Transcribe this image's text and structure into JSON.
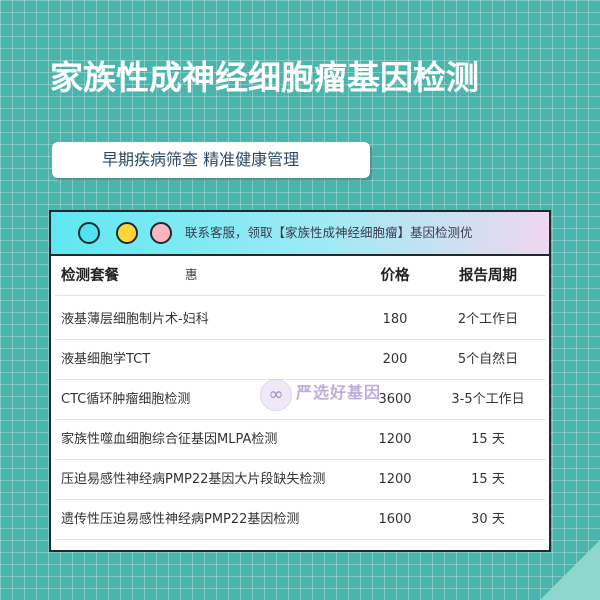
{
  "header": {
    "title": "家族性成神经细胞瘤基因检测",
    "subtitle": "早期疾病筛查 精准健康管理"
  },
  "panel": {
    "notice_line": "联系客服，领取【家族性成神经细胞瘤】基因检测优",
    "notice_tail": "惠",
    "dots": [
      "cyan",
      "yellow",
      "pink"
    ]
  },
  "table": {
    "headers": {
      "name": "检测套餐",
      "price": "价格",
      "period": "报告周期"
    },
    "rows": [
      {
        "name": "液基薄层细胞制片术-妇科",
        "price": "180",
        "period": "2个工作日"
      },
      {
        "name": "液基细胞学TCT",
        "price": "200",
        "period": "5个自然日"
      },
      {
        "name": "CTC循环肿瘤细胞检测",
        "price": "3600",
        "period": "3-5个工作日"
      },
      {
        "name": "家族性噬血细胞综合征基因MLPA检测",
        "price": "1200",
        "period": "15 天"
      },
      {
        "name": "压迫易感性神经病PMP22基因大片段缺失检测",
        "price": "1200",
        "period": "15 天"
      },
      {
        "name": "遗传性压迫易感性神经病PMP22基因检测",
        "price": "1600",
        "period": "30 天"
      }
    ]
  },
  "watermark": {
    "text": "严选好基因"
  },
  "colors": {
    "background": "#4ab5ac",
    "dot_cyan": "#4fe2f0",
    "dot_yellow": "#ffd53a",
    "dot_pink": "#f7b6c3"
  }
}
